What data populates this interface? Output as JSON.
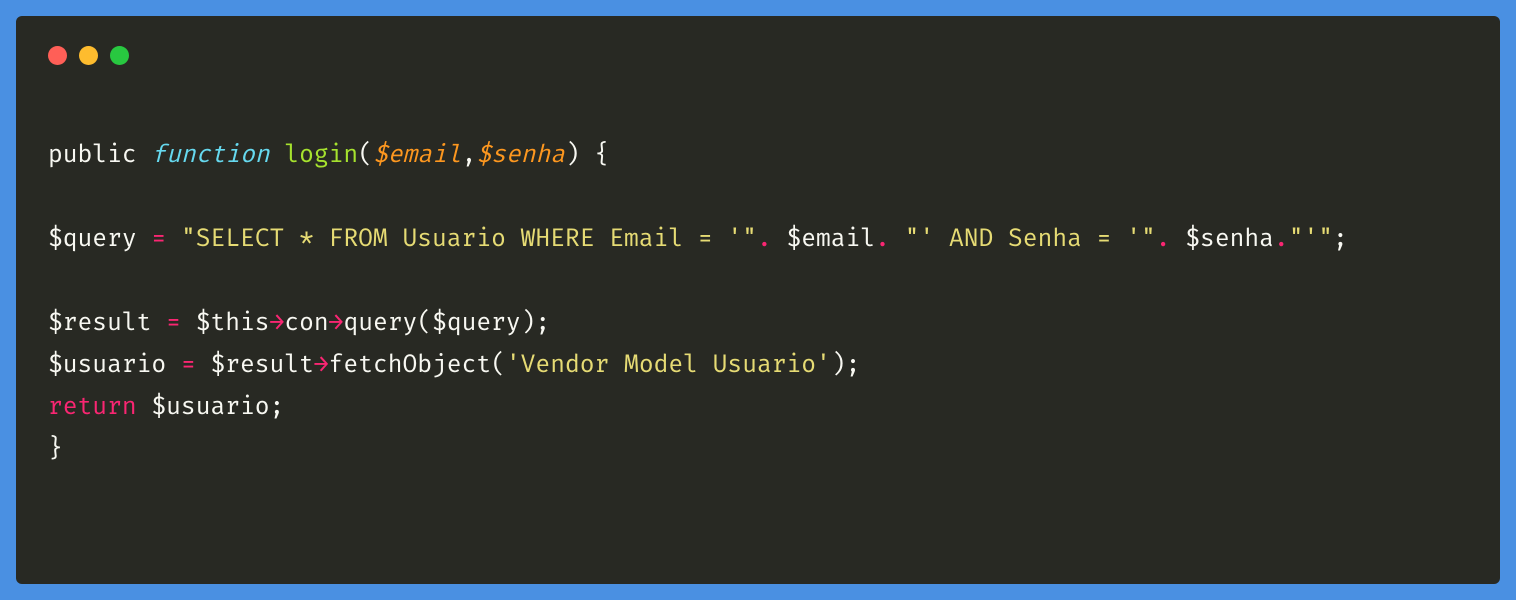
{
  "window": {
    "traffic_lights": {
      "red": "close",
      "yellow": "minimize",
      "green": "maximize"
    }
  },
  "code": {
    "lines": [
      {
        "tokens": [
          {
            "t": "public ",
            "cls": "tok-default"
          },
          {
            "t": "function ",
            "cls": "tok-type"
          },
          {
            "t": "login",
            "cls": "tok-funcname"
          },
          {
            "t": "(",
            "cls": "tok-punc"
          },
          {
            "t": "$email",
            "cls": "tok-param"
          },
          {
            "t": ",",
            "cls": "tok-punc"
          },
          {
            "t": "$senha",
            "cls": "tok-param"
          },
          {
            "t": ") {",
            "cls": "tok-punc"
          }
        ]
      },
      {
        "tokens": [
          {
            "t": "",
            "cls": "tok-default"
          }
        ]
      },
      {
        "tokens": [
          {
            "t": "$query ",
            "cls": "tok-var"
          },
          {
            "t": "= ",
            "cls": "tok-keyword"
          },
          {
            "t": "\"SELECT * FROM Usuario WHERE Email = '\"",
            "cls": "tok-string"
          },
          {
            "t": ". ",
            "cls": "tok-keyword"
          },
          {
            "t": "$email",
            "cls": "tok-var"
          },
          {
            "t": ". ",
            "cls": "tok-keyword"
          },
          {
            "t": "\"' AND Senha = '\"",
            "cls": "tok-string"
          },
          {
            "t": ". ",
            "cls": "tok-keyword"
          },
          {
            "t": "$senha",
            "cls": "tok-var"
          },
          {
            "t": ".",
            "cls": "tok-keyword"
          },
          {
            "t": "\"'\"",
            "cls": "tok-string"
          },
          {
            "t": ";",
            "cls": "tok-punc"
          }
        ]
      },
      {
        "tokens": [
          {
            "t": "",
            "cls": "tok-default"
          }
        ]
      },
      {
        "tokens": [
          {
            "t": "$result ",
            "cls": "tok-var"
          },
          {
            "t": "= ",
            "cls": "tok-keyword"
          },
          {
            "t": "$this",
            "cls": "tok-var"
          },
          {
            "t": "→",
            "cls": "tok-keyword"
          },
          {
            "t": "con",
            "cls": "tok-var"
          },
          {
            "t": "→",
            "cls": "tok-keyword"
          },
          {
            "t": "query($query);",
            "cls": "tok-var"
          }
        ]
      },
      {
        "tokens": [
          {
            "t": "$usuario ",
            "cls": "tok-var"
          },
          {
            "t": "= ",
            "cls": "tok-keyword"
          },
          {
            "t": "$result",
            "cls": "tok-var"
          },
          {
            "t": "→",
            "cls": "tok-keyword"
          },
          {
            "t": "fetchObject(",
            "cls": "tok-var"
          },
          {
            "t": "'Vendor Model Usuario'",
            "cls": "tok-string"
          },
          {
            "t": ");",
            "cls": "tok-punc"
          }
        ]
      },
      {
        "tokens": [
          {
            "t": "return ",
            "cls": "tok-keyword"
          },
          {
            "t": "$usuario;",
            "cls": "tok-var"
          }
        ]
      },
      {
        "tokens": [
          {
            "t": "}",
            "cls": "tok-punc"
          }
        ]
      }
    ]
  }
}
